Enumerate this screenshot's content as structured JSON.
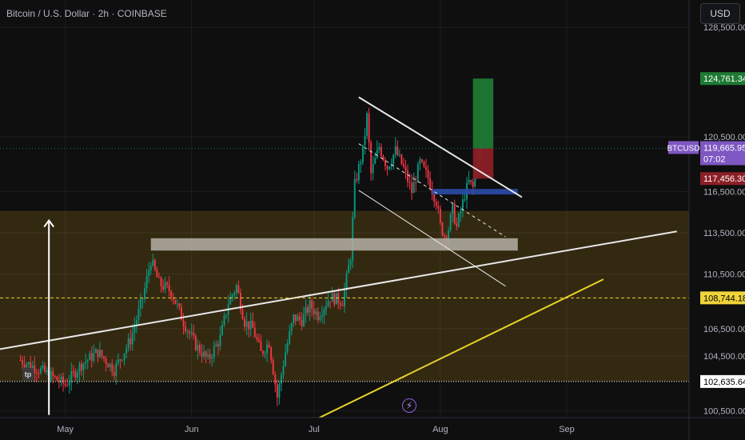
{
  "header": {
    "title": "Bitcoin / U.S. Dollar · 2h · COINBASE",
    "currency_button": "USD"
  },
  "badges": {
    "tp": "tp"
  },
  "colors": {
    "background": "#0f0f10",
    "zone": "#3a2e12",
    "up_candle": "#089981",
    "down_candle": "#f23645",
    "trendline": "#e8e8e8",
    "yellow_line": "#e6d32a",
    "support_box": "#b5b0a6",
    "entry_box": "#2b4da8",
    "target_box": "#1e7a33",
    "stop_box": "#8b1f26",
    "btc_label": "#7e57c2",
    "dotted_level": "#f0d43a"
  },
  "chart_data": {
    "type": "candlestick",
    "symbol": "BTCUSD",
    "interval": "2h",
    "x_ticks": [
      "May",
      "Jun",
      "Jul",
      "Aug",
      "Sep"
    ],
    "x_tick_dates": [
      "2025-05-01",
      "2025-06-01",
      "2025-07-01",
      "2025-08-01",
      "2025-09-01"
    ],
    "y_ticks": [
      128500,
      120500,
      116500,
      113500,
      110500,
      106500,
      104500,
      100500
    ],
    "y_tick_labels": [
      "128,500.00",
      "120,500.00",
      "116,500.00",
      "113,500.00",
      "110,500.00",
      "106,500.00",
      "104,500.00",
      "100,500.00"
    ],
    "price_labels": [
      {
        "name": "target",
        "text": "124,761.34",
        "value": 124761.34,
        "color": "#1e7a33"
      },
      {
        "name": "current",
        "text": "119,665.95",
        "countdown": "07:02",
        "symbol": "BTCUSD",
        "value": 119665.95,
        "color": "#7e57c2"
      },
      {
        "name": "stop",
        "text": "117,456.30",
        "value": 117456.3,
        "color": "#8b1f26"
      },
      {
        "name": "level",
        "text": "108,744.18",
        "value": 108744.18,
        "color": "#f0d43a"
      },
      {
        "name": "bottom",
        "text": "102,635.64",
        "value": 102635.64,
        "color": "#ffffff"
      }
    ],
    "price_path": [
      [
        "2025-04-20",
        104200
      ],
      [
        "2025-04-26",
        103300
      ],
      [
        "2025-05-01",
        102400
      ],
      [
        "2025-05-05",
        103900
      ],
      [
        "2025-05-09",
        104800
      ],
      [
        "2025-05-13",
        103500
      ],
      [
        "2025-05-17",
        105700
      ],
      [
        "2025-05-20",
        108700
      ],
      [
        "2025-05-22",
        111500
      ],
      [
        "2025-05-24",
        109800
      ],
      [
        "2025-05-27",
        109200
      ],
      [
        "2025-05-30",
        107000
      ],
      [
        "2025-06-02",
        105300
      ],
      [
        "2025-06-05",
        104200
      ],
      [
        "2025-06-08",
        105800
      ],
      [
        "2025-06-10",
        108400
      ],
      [
        "2025-06-12",
        109600
      ],
      [
        "2025-06-14",
        107000
      ],
      [
        "2025-06-16",
        106500
      ],
      [
        "2025-06-18",
        104700
      ],
      [
        "2025-06-20",
        105500
      ],
      [
        "2025-06-22",
        101500
      ],
      [
        "2025-06-24",
        104800
      ],
      [
        "2025-06-26",
        107300
      ],
      [
        "2025-06-28",
        107100
      ],
      [
        "2025-06-30",
        108200
      ],
      [
        "2025-07-02",
        107500
      ],
      [
        "2025-07-05",
        108800
      ],
      [
        "2025-07-08",
        108500
      ],
      [
        "2025-07-10",
        111800
      ],
      [
        "2025-07-11",
        117000
      ],
      [
        "2025-07-13",
        119500
      ],
      [
        "2025-07-14",
        122000
      ],
      [
        "2025-07-15",
        117800
      ],
      [
        "2025-07-17",
        119800
      ],
      [
        "2025-07-19",
        118300
      ],
      [
        "2025-07-21",
        119500
      ],
      [
        "2025-07-23",
        118200
      ],
      [
        "2025-07-25",
        116500
      ],
      [
        "2025-07-27",
        118600
      ],
      [
        "2025-07-29",
        117500
      ],
      [
        "2025-07-31",
        115800
      ],
      [
        "2025-08-01",
        114000
      ],
      [
        "2025-08-02",
        113300
      ],
      [
        "2025-08-03",
        113800
      ],
      [
        "2025-08-04",
        115200
      ],
      [
        "2025-08-05",
        113900
      ],
      [
        "2025-08-07",
        116300
      ],
      [
        "2025-08-08",
        117200
      ],
      [
        "2025-08-09",
        116800
      ],
      [
        "2025-08-10",
        118800
      ],
      [
        "2025-08-11",
        119665.95
      ]
    ],
    "annotations": {
      "zone": {
        "price_top": 115100,
        "price_bottom": 102635.64
      },
      "support_box": {
        "start": "2025-05-22",
        "end": "2025-08-20",
        "price_top": 113100,
        "price_bottom": 112200
      },
      "entry_box": {
        "start": "2025-07-30",
        "end": "2025-08-20",
        "price_top": 116700,
        "price_bottom": 116300
      },
      "position": {
        "start": "2025-08-09",
        "end": "2025-08-14",
        "entry": 119665.95,
        "target": 124761.34,
        "stop": 117456.3
      },
      "channel_top": [
        [
          "2025-07-12",
          123400
        ],
        [
          "2025-08-21",
          116100
        ]
      ],
      "channel_bottom": [
        [
          "2025-07-12",
          116600
        ],
        [
          "2025-08-17",
          109600
        ]
      ],
      "channel_mid": [
        [
          "2025-07-12",
          120000
        ],
        [
          "2025-08-17",
          113200
        ]
      ],
      "long_trendline": [
        [
          "2025-04-15",
          105000
        ],
        [
          "2025-09-28",
          113600
        ]
      ],
      "yellow_line": [
        [
          "2025-07-01",
          99800
        ],
        [
          "2025-09-10",
          110100
        ]
      ],
      "arrow": {
        "date": "2025-04-27",
        "from": 100200,
        "to": 114400
      },
      "bottom_level": 102635.64,
      "dotted_level": 108744.18
    },
    "ylim": [
      100000,
      130500
    ],
    "xlim": [
      "2025-04-15",
      "2025-10-01"
    ],
    "grid": true
  }
}
